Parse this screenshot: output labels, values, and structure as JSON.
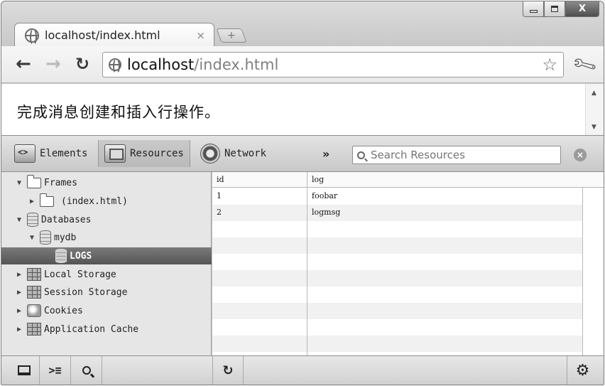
{
  "browser": {
    "tab_title": "localhost/index.html",
    "tab_close": "×",
    "new_tab": "+",
    "url_host": "localhost",
    "url_path": "/index.html",
    "controls": {
      "minimize": "",
      "maximize": "",
      "close": "X"
    }
  },
  "page": {
    "text": "完成消息创建和插入行操作。"
  },
  "devtools": {
    "tabs": [
      {
        "label": "Elements",
        "icon": "elements-icon"
      },
      {
        "label": "Resources",
        "icon": "resources-icon",
        "active": true
      },
      {
        "label": "Network",
        "icon": "network-icon"
      }
    ],
    "more": "»",
    "search_placeholder": "Search Resources",
    "close": "×"
  },
  "sidebar": {
    "items": [
      {
        "label": "Frames",
        "expanded": true
      },
      {
        "label": "(index.html)"
      },
      {
        "label": "Databases",
        "expanded": true
      },
      {
        "label": "mydb",
        "expanded": true
      },
      {
        "label": "LOGS",
        "selected": true
      },
      {
        "label": "Local Storage"
      },
      {
        "label": "Session Storage"
      },
      {
        "label": "Cookies"
      },
      {
        "label": "Application Cache"
      }
    ]
  },
  "table": {
    "columns": [
      "id",
      "log"
    ],
    "rows": [
      [
        "1",
        "foobar"
      ],
      [
        "2",
        "logmsg"
      ]
    ]
  },
  "colors": {
    "selection": "#5f5f5f",
    "row_alt": "#f1f1f1"
  }
}
